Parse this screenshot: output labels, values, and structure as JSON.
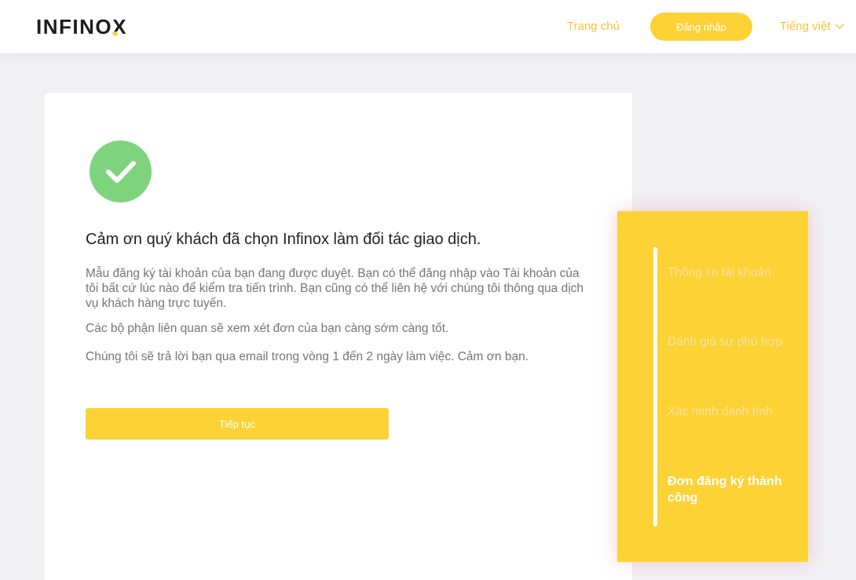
{
  "header": {
    "logo": "INFINOX",
    "nav_home": "Trang chủ",
    "login": "Đăng nhập",
    "language": "Tiếng việt"
  },
  "main": {
    "title": "Cảm ơn quý khách đã chọn Infinox làm đối tác giao dịch.",
    "paragraph1": "Mẫu đăng ký tài khoản của bạn đang được duyệt. Bạn có thể đăng nhập vào Tài khoản của tôi bất cứ lúc nào để kiểm tra tiến trình. Bạn cũng có thể liên hệ với chúng tôi thông qua dịch vụ khách hàng trực tuyến.",
    "paragraph2": "Các bộ phận liên quan sẽ xem xét đơn của bạn càng sớm càng tốt.",
    "paragraph3": "Chúng tôi sẽ trả lời bạn qua email trong vòng 1 đến 2 ngày làm việc. Cảm ơn bạn.",
    "continue": "Tiếp tục"
  },
  "steps": {
    "items": [
      {
        "label": "Thông tin tài khoản",
        "active": false
      },
      {
        "label": "Đánh giá sự phù hợp",
        "active": false
      },
      {
        "label": "Xác minh danh tính",
        "active": false
      },
      {
        "label": "Đơn đăng ký thành công",
        "active": true
      }
    ]
  },
  "colors": {
    "accent": "#fdd235",
    "link": "#f6c33b",
    "success": "#7ed47c",
    "background": "#f1f1f3"
  },
  "icons": {
    "logo_dot": "logo-dot-icon",
    "chevron": "chevron-down-icon",
    "check": "check-circle-icon"
  }
}
